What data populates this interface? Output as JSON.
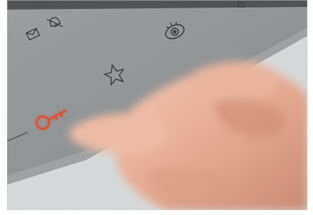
{
  "photo": {
    "colors": {
      "panel": "#8f9395",
      "panel_edge": "#6f7274",
      "icon_stroke": "#3a3d3f",
      "key_glow": "#e24a2b",
      "skin": "#e9b39b",
      "background": "#d9dcdd"
    },
    "icons": [
      "envelope-icon",
      "bell-off-icon",
      "eye-icon",
      "star-icon",
      "key-icon"
    ],
    "highlighted_icon": "key-icon"
  }
}
